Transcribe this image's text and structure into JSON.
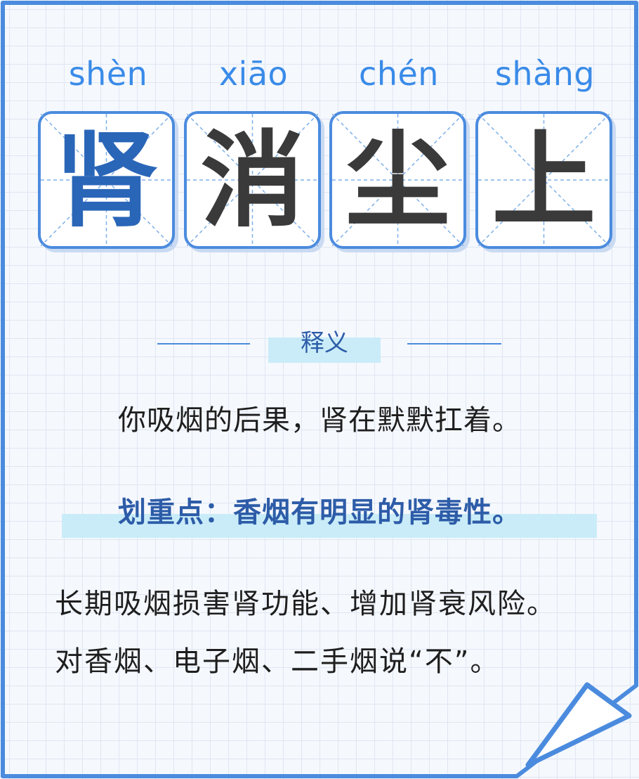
{
  "idiom": {
    "characters": [
      {
        "pinyin": "shèn",
        "hanzi": "肾",
        "color": "#2a66b8"
      },
      {
        "pinyin": "xiāo",
        "hanzi": "消",
        "color": "#3a3a3a"
      },
      {
        "pinyin": "chén",
        "hanzi": "尘",
        "color": "#3a3a3a"
      },
      {
        "pinyin": "shàng",
        "hanzi": "上",
        "color": "#3a3a3a"
      }
    ]
  },
  "section": {
    "title": "释义"
  },
  "definition": "你吸烟的后果，肾在默默扛着。",
  "key_point": "划重点：香烟有明显的肾毒性。",
  "body": [
    "长期吸烟损害肾功能、增加肾衰风险。",
    "对香烟、电子烟、二手烟说“不”。"
  ],
  "colors": {
    "accent": "#4b8bde",
    "pinyin": "#3a8be8",
    "highlight": "#c9ecf8",
    "key_point_text": "#2d5ca8",
    "body_text": "#1e1e1e"
  }
}
